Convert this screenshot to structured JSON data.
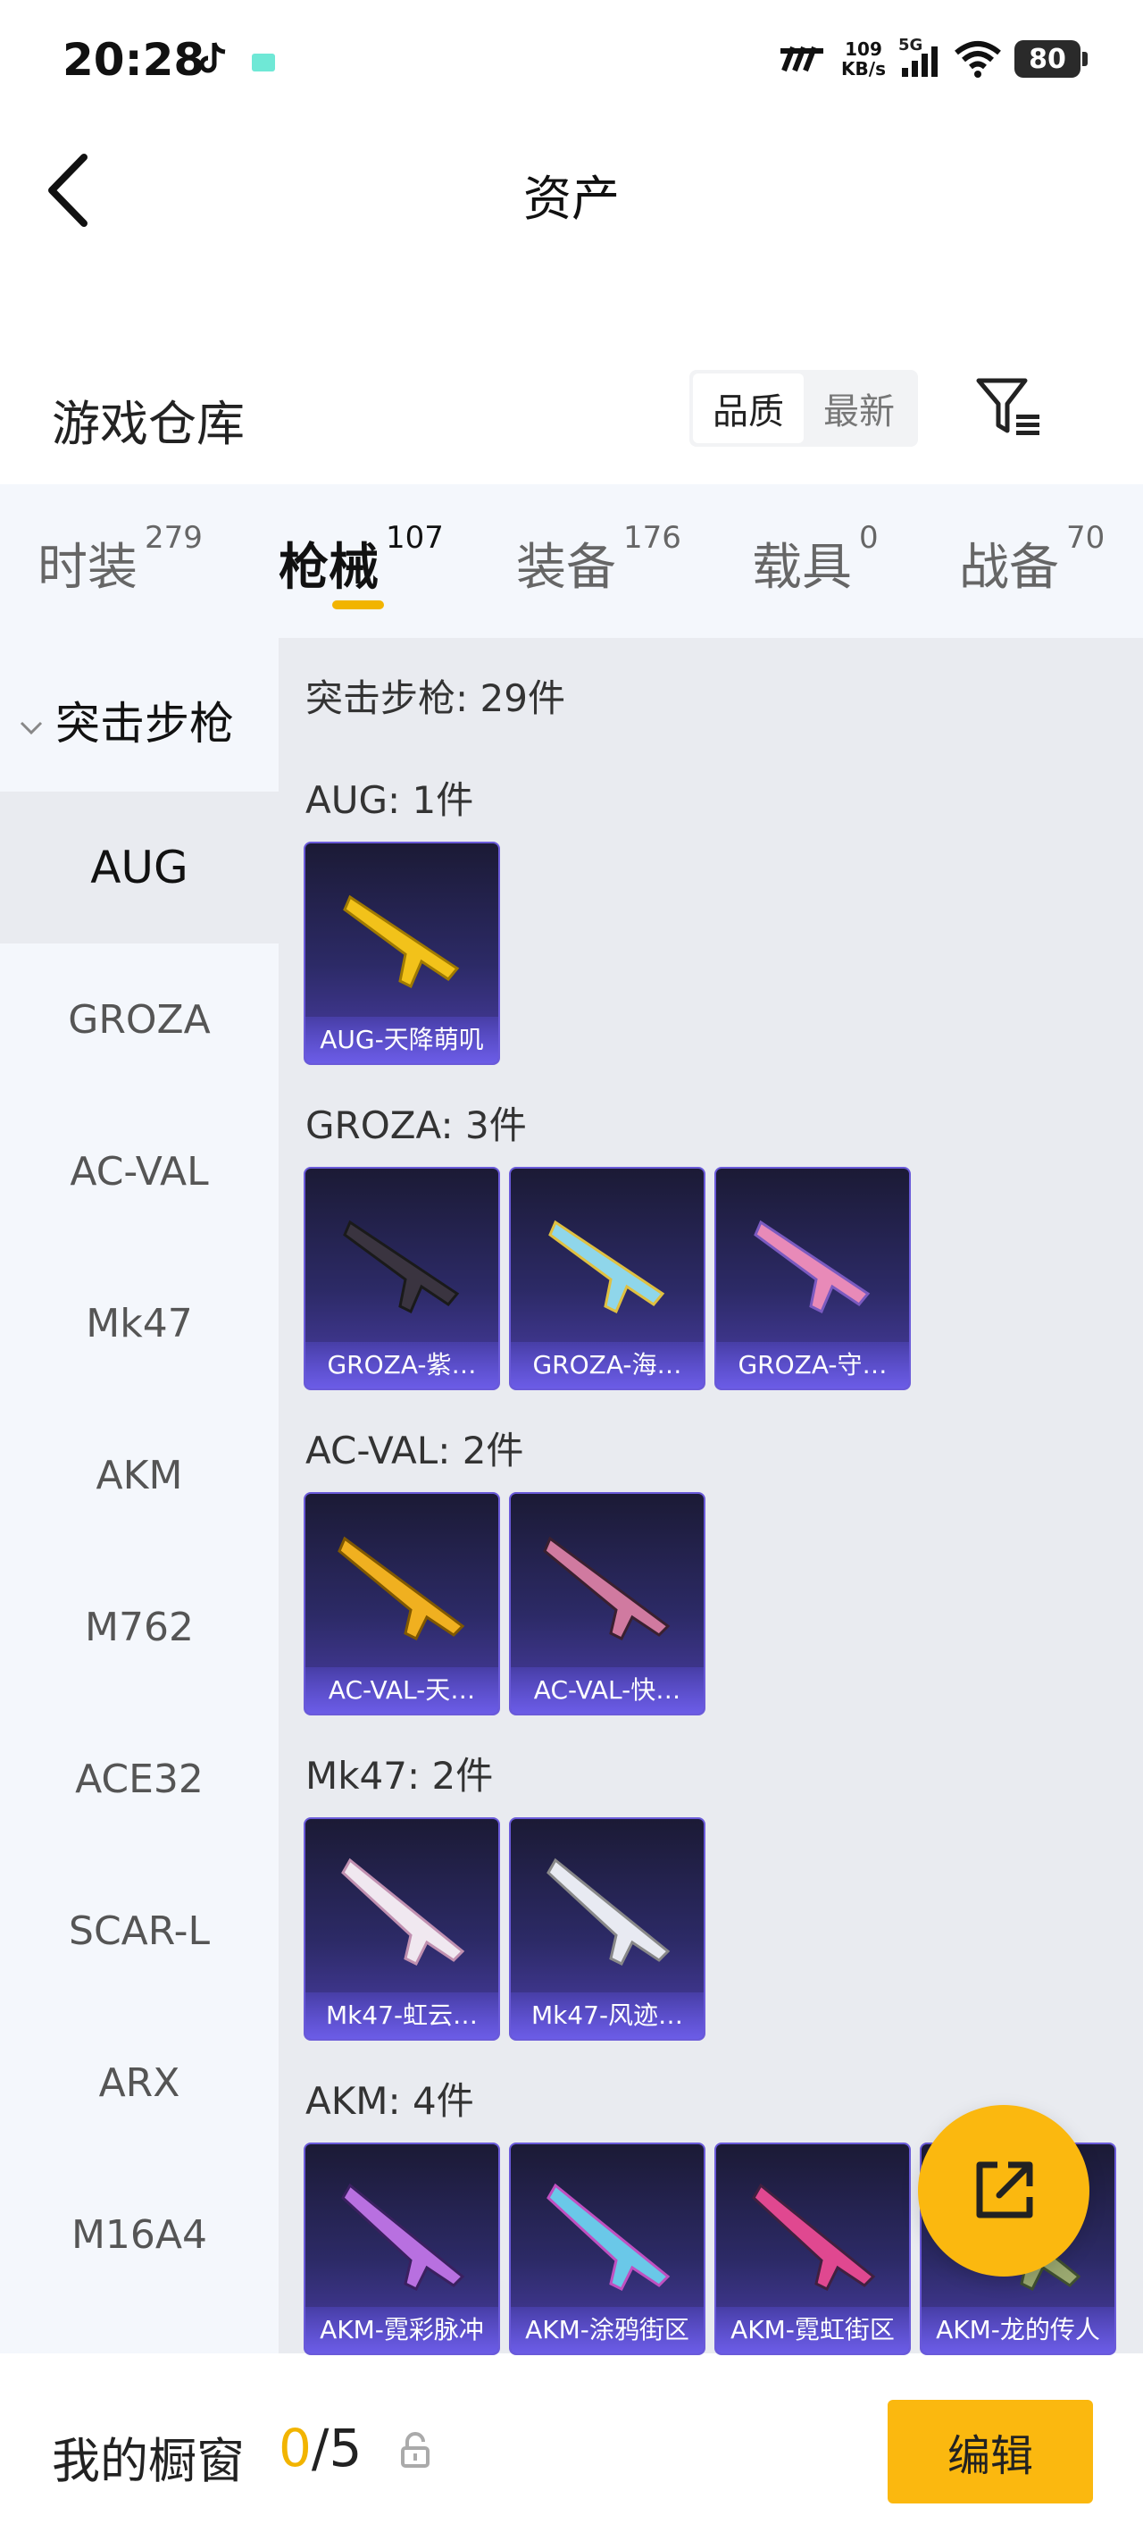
{
  "status": {
    "time": "20:28",
    "speed_value": "109",
    "speed_unit": "KB/s",
    "network": "5G",
    "battery": "80"
  },
  "header": {
    "title": "资产"
  },
  "warehouse": {
    "title": "游戏仓库",
    "sort_quality": "品质",
    "sort_latest": "最新"
  },
  "tabs": [
    {
      "label": "时装",
      "count": "279"
    },
    {
      "label": "枪械",
      "count": "107"
    },
    {
      "label": "装备",
      "count": "176"
    },
    {
      "label": "载具",
      "count": "0"
    },
    {
      "label": "战备",
      "count": "70"
    }
  ],
  "sidebar": {
    "group": "突击步枪",
    "items": [
      "AUG",
      "GROZA",
      "AC-VAL",
      "Mk47",
      "AKM",
      "M762",
      "ACE32",
      "SCAR-L",
      "ARX",
      "M16A4"
    ]
  },
  "content": {
    "total": "突击步枪: 29件",
    "sections": [
      {
        "title": "AUG: 1件",
        "items": [
          "AUG-天降萌叽"
        ]
      },
      {
        "title": "GROZA: 3件",
        "items": [
          "GROZA-紫…",
          "GROZA-海…",
          "GROZA-守…"
        ]
      },
      {
        "title": "AC-VAL: 2件",
        "items": [
          "AC-VAL-天…",
          "AC-VAL-快…"
        ]
      },
      {
        "title": "Mk47: 2件",
        "items": [
          "Mk47-虹云…",
          "Mk47-风迹…"
        ]
      },
      {
        "title": "AKM: 4件",
        "items": [
          "AKM-霓彩脉冲",
          "AKM-涂鸦街区",
          "AKM-霓虹街区",
          "AKM-龙的传人"
        ]
      }
    ]
  },
  "showcase": {
    "label": "我的橱窗",
    "current": "0",
    "total": "/5",
    "edit": "编辑"
  },
  "colors": {
    "accent": "#fbb80f",
    "card_top": "#1b1a35",
    "card_bottom": "#4b3ea8"
  },
  "icons": [
    "back-arrow-icon",
    "filter-icon",
    "chevron-down-icon",
    "share-icon",
    "lock-icon",
    "tiktok-icon",
    "wifi-icon",
    "signal-icon"
  ]
}
